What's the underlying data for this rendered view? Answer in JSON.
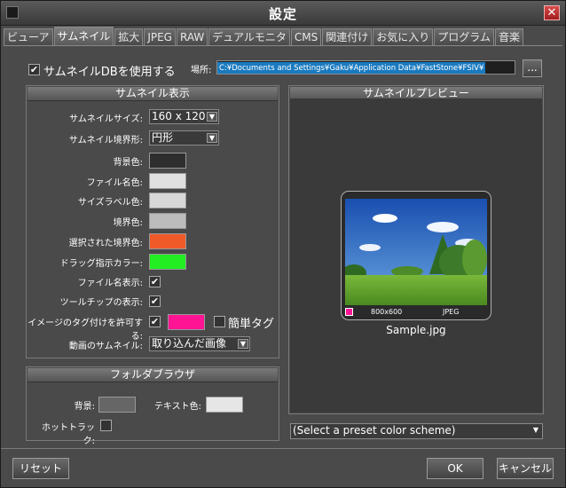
{
  "window": {
    "title": "設定"
  },
  "tabs": [
    "ビューア",
    "サムネイル",
    "拡大",
    "JPEG",
    "RAW",
    "デュアルモニタ",
    "CMS",
    "関連付け",
    "お気に入り",
    "プログラム",
    "音楽"
  ],
  "top": {
    "use_db_label": "サムネイルDBを使用する",
    "use_db_checked": true,
    "location_label": "場所:",
    "location_value": "C:¥Documents and Settings¥Gaku¥Application Data¥FastStone¥FSIV¥",
    "browse_label": "..."
  },
  "thumbnail_display": {
    "header": "サムネイル表示",
    "size_label": "サムネイルサイズ:",
    "size_value": "160 x 120",
    "border_shape_label": "サムネイル境界形:",
    "border_shape_value": "円形",
    "bg_label": "背景色:",
    "filename_color_label": "ファイル名色:",
    "size_label_color_label": "サイズラベル色:",
    "border_color_label": "境界色:",
    "selected_border_label": "選択された境界色:",
    "drag_color_label": "ドラッグ指示カラー:",
    "show_filename_label": "ファイル名表示:",
    "show_tooltip_label": "ツールチップの表示:",
    "allow_tagging_label": "イメージのタグ付けを許可する:",
    "simple_tag_label": "簡単タグ",
    "video_thumb_label": "動画のサムネイル:",
    "video_thumb_value": "取り込んだ画像",
    "colors": {
      "bg": "#2e2e2e",
      "filename": "#e0e0e0",
      "size_label": "#d8d8d8",
      "border": "#bcbcbc",
      "selected_border": "#f05a28",
      "drag": "#22ee22",
      "tag": "#ff1493"
    }
  },
  "folder_browser": {
    "header": "フォルダブラウザ",
    "bg_label": "背景:",
    "text_color_label": "テキスト色:",
    "hottrack_label": "ホットトラック:",
    "colors": {
      "bg": "#666666",
      "text": "#e6e6e6"
    }
  },
  "preview": {
    "header": "サムネイルプレビュー",
    "dimensions": "800x600",
    "format": "JPEG",
    "filename": "Sample.jpg",
    "scheme_placeholder": "(Select a preset color scheme)"
  },
  "footer": {
    "reset": "リセット",
    "ok": "OK",
    "cancel": "キャンセル"
  }
}
